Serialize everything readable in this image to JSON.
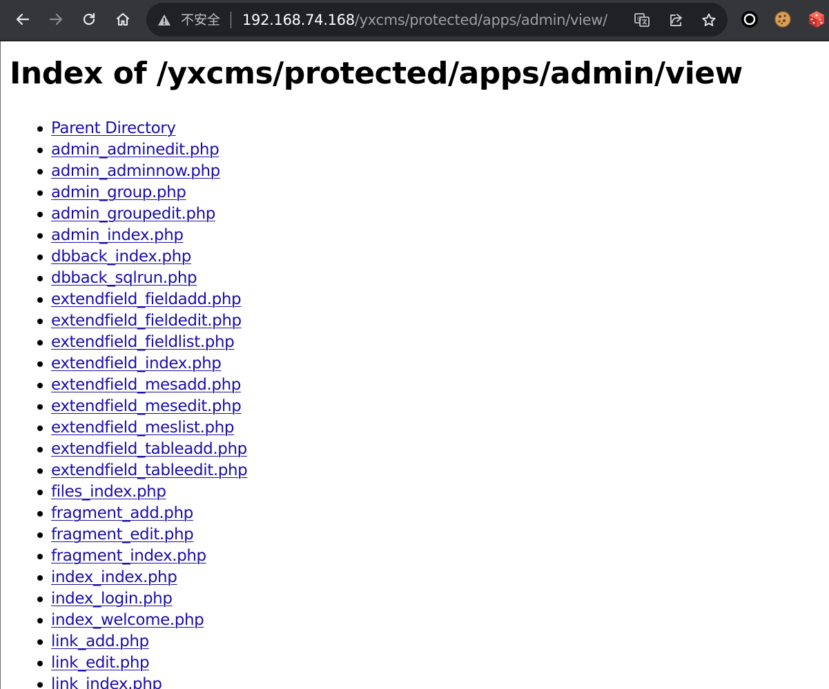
{
  "browser": {
    "security_label": "不安全",
    "url_host": "192.168.74.168",
    "url_path": "/yxcms/protected/apps/admin/view/",
    "icons": [
      "back-icon",
      "forward-icon",
      "reload-icon",
      "home-icon",
      "warning-icon",
      "translate-icon",
      "share-icon",
      "star-icon",
      "extension-circle-icon",
      "cookie-icon",
      "dice-icon"
    ],
    "colors": {
      "toolbar_bg": "#35363a",
      "omnibox_bg": "#202124",
      "link": "#1a0dab"
    }
  },
  "page": {
    "title": "Index of /yxcms/protected/apps/admin/view",
    "entries": [
      "Parent Directory",
      "admin_adminedit.php",
      "admin_adminnow.php",
      "admin_group.php",
      "admin_groupedit.php",
      "admin_index.php",
      "dbback_index.php",
      "dbback_sqlrun.php",
      "extendfield_fieldadd.php",
      "extendfield_fieldedit.php",
      "extendfield_fieldlist.php",
      "extendfield_index.php",
      "extendfield_mesadd.php",
      "extendfield_mesedit.php",
      "extendfield_meslist.php",
      "extendfield_tableadd.php",
      "extendfield_tableedit.php",
      "files_index.php",
      "fragment_add.php",
      "fragment_edit.php",
      "fragment_index.php",
      "index_index.php",
      "index_login.php",
      "index_welcome.php",
      "link_add.php",
      "link_edit.php",
      "link_index.php"
    ]
  }
}
